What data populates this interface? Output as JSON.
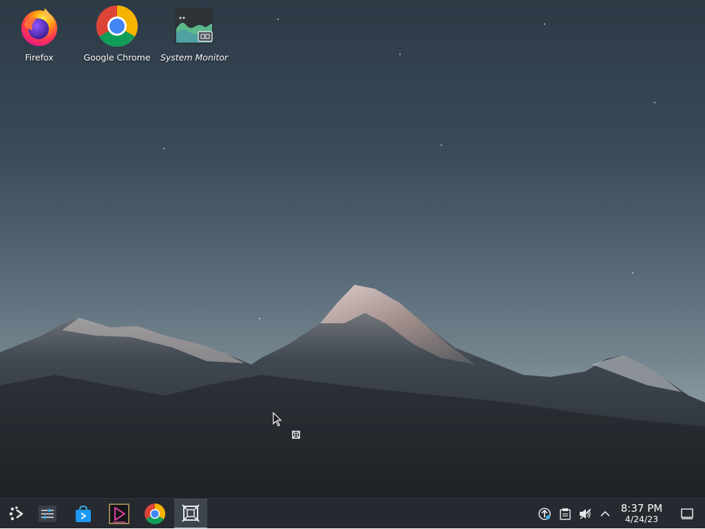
{
  "desktop": {
    "icons": [
      {
        "label": "Firefox",
        "icon": "firefox-icon"
      },
      {
        "label": "Google Chrome",
        "icon": "chrome-icon"
      },
      {
        "label": "System Monitor",
        "icon": "system-monitor-icon"
      }
    ]
  },
  "taskbar": {
    "launcher_icon": "application-launcher-icon",
    "apps": [
      {
        "icon": "settings-sliders-icon"
      },
      {
        "icon": "discover-store-icon"
      },
      {
        "icon": "media-player-icon"
      },
      {
        "icon": "chrome-icon"
      },
      {
        "icon": "window-manager-icon",
        "active": true
      }
    ],
    "tray": [
      "update-notifier-icon",
      "clipboard-icon",
      "volume-muted-icon",
      "expand-tray-icon"
    ],
    "clock": {
      "time": "8:37 PM",
      "date": "4/24/23"
    },
    "show_desktop_icon": "show-desktop-icon"
  },
  "colors": {
    "taskbar_bg": "#262a30",
    "active_task_bg": "#3f454d"
  }
}
